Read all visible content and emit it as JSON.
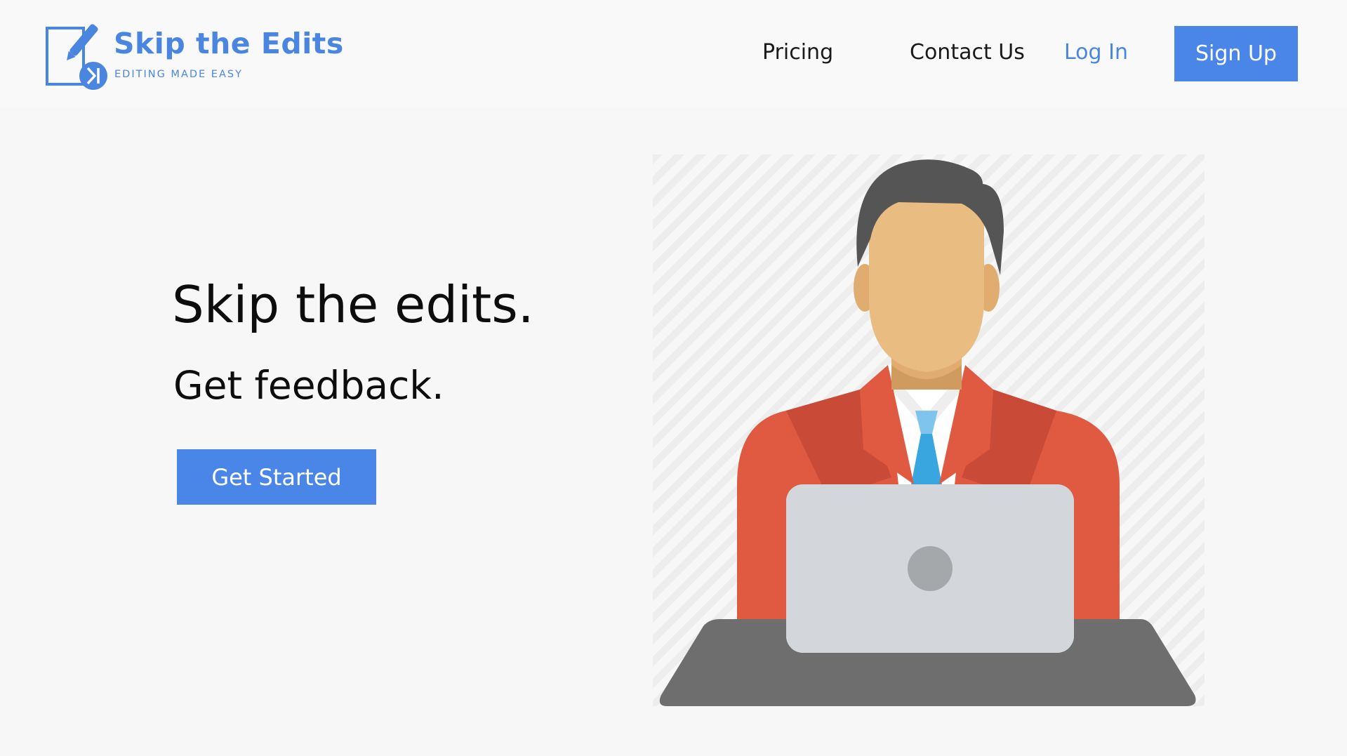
{
  "brand": {
    "name": "Skip the Edits",
    "tagline": "EDITING MADE EASY",
    "logo_icon": "edit-skip-icon",
    "color": "#4a86e0"
  },
  "nav": {
    "pricing": "Pricing",
    "contact": "Contact Us",
    "login": "Log In",
    "signup": "Sign Up"
  },
  "hero": {
    "title": "Skip the edits.",
    "subtitle": "Get feedback.",
    "cta": "Get Started",
    "illustration": "person-at-laptop-illustration"
  },
  "colors": {
    "accent": "#4a86e8",
    "page_bg": "#f7f7f7",
    "header_bg": "#f9f9f9",
    "suit": "#e05a42",
    "skin": "#e9bd82",
    "hair": "#555555",
    "laptop": "#d3d6da",
    "desk": "#6e6e6e",
    "tie": "#4aaee5"
  }
}
